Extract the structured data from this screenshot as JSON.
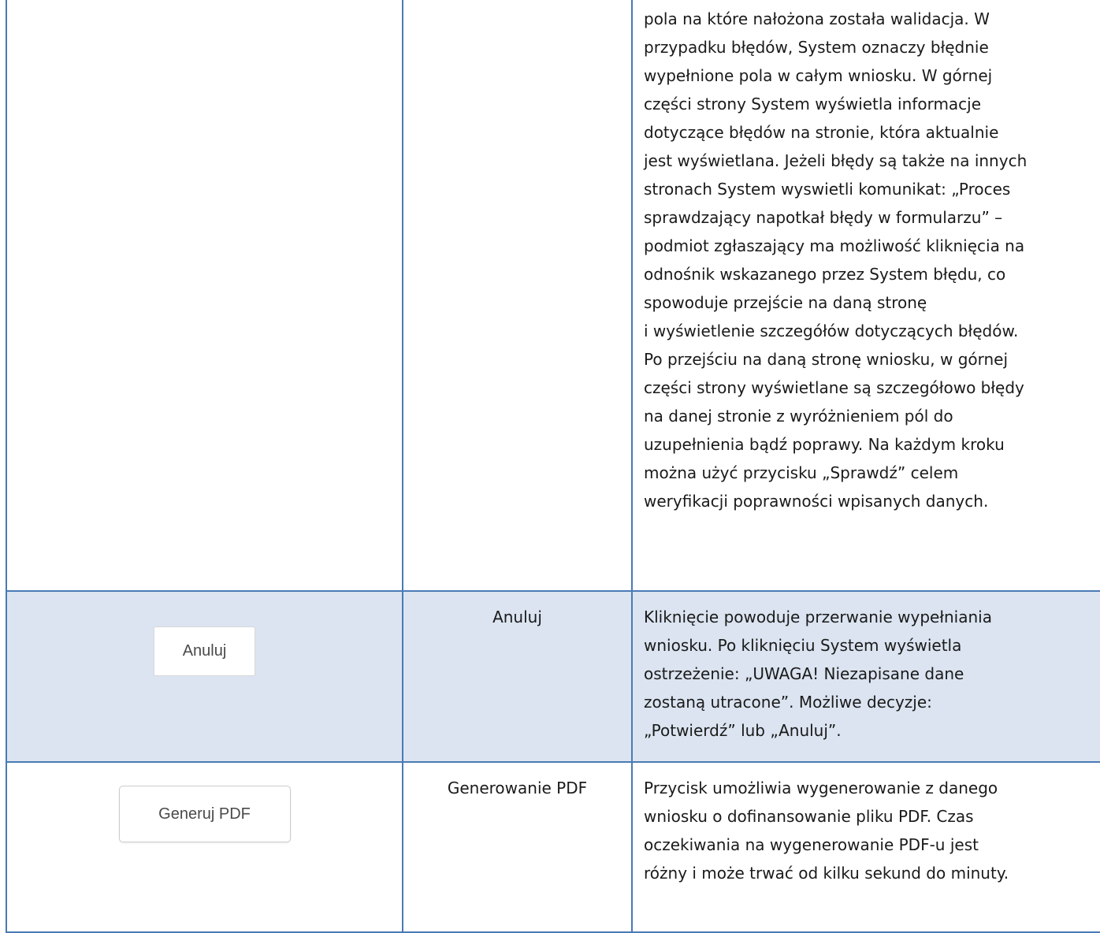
{
  "rows": [
    {
      "name": "",
      "description": "pola na które nałożona została walidacja. W\nprzypadku błędów, System oznaczy błędnie\nwypełnione pola w całym wniosku. W górnej\nczęści strony System wyświetla informacje\ndotyczące błędów na stronie, która aktualnie\njest wyświetlana. Jeżeli błędy są także na innych\nstronach System wyswietli komunikat: „Proces\nsprawdzający napotkał błędy w formularzu” –\npodmiot zgłaszający ma możliwość kliknięcia na\nodnośnik wskazanego przez System błędu, co\nspowoduje przejście na daną stronę\ni wyświetlenie szczegółów dotyczących błędów.\nPo przejściu na daną stronę wniosku, w górnej\nczęści strony wyświetlane są szczegółowo błędy\nna danej stronie z wyróżnieniem pól do\nuzupełnienia bądź poprawy. Na każdym kroku\nmożna użyć przycisku „Sprawdź” celem\nweryfikacji poprawności wpisanych danych."
    },
    {
      "button_label": "Anuluj",
      "name": "Anuluj",
      "description": "Kliknięcie powoduje przerwanie wypełniania\nwniosku. Po kliknięciu System wyświetla\nostrzeżenie: „UWAGA! Niezapisane dane\nzostaną utracone”. Możliwe decyzje:\n„Potwierdź” lub „Anuluj”."
    },
    {
      "button_label": "Generuj PDF",
      "name": "Generowanie PDF",
      "description": "Przycisk umożliwia wygenerowanie z danego\nwniosku o dofinansowanie pliku PDF. Czas\noczekiwania na wygenerowanie PDF-u jest\nróżny i może trwać od kilku sekund do minuty."
    }
  ],
  "colors": {
    "border": "#4a7ab5",
    "shaded_row": "#dbe4f0"
  }
}
